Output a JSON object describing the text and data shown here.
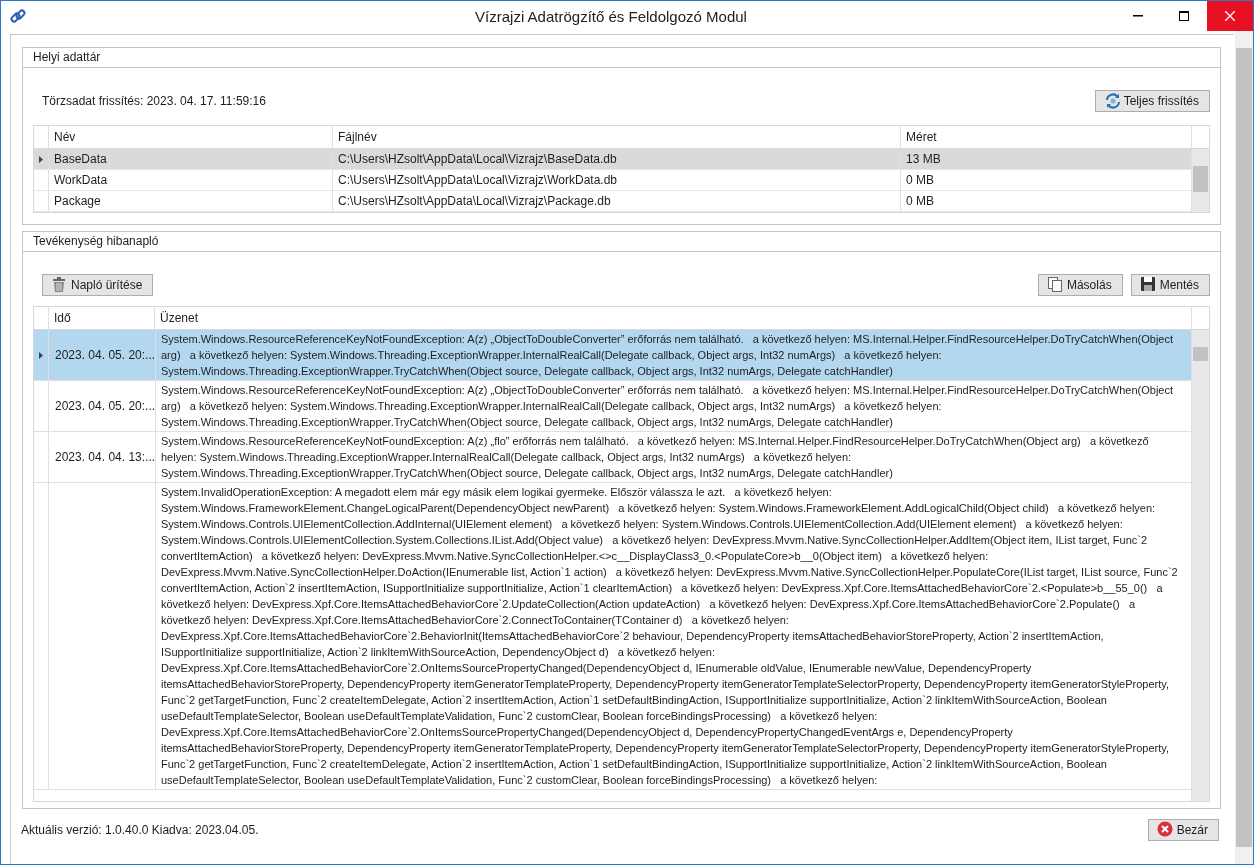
{
  "window": {
    "title": "Vízrajzi Adatrögzítő és Feldolgozó Modul"
  },
  "local_store": {
    "title": "Helyi adattár",
    "sync_label": "Törzsadat frissítés: 2023. 04. 17. 11:59:16",
    "refresh_button": "Teljes frissítés",
    "columns": [
      "Név",
      "Fájlnév",
      "Méret"
    ],
    "rows": [
      {
        "name": "BaseData",
        "file": "C:\\Users\\HZsolt\\AppData\\Local\\Vizrajz\\BaseData.db",
        "size": "13 MB",
        "selected": true
      },
      {
        "name": "WorkData",
        "file": "C:\\Users\\HZsolt\\AppData\\Local\\Vizrajz\\WorkData.db",
        "size": "0 MB",
        "selected": false
      },
      {
        "name": "Package",
        "file": "C:\\Users\\HZsolt\\AppData\\Local\\Vizrajz\\Package.db",
        "size": "0 MB",
        "selected": false
      }
    ]
  },
  "error_log": {
    "title": "Tevékenység hibanapló",
    "clear_button": "Napló ürítése",
    "copy_button": "Másolás",
    "save_button": "Mentés",
    "columns": [
      "Idő",
      "Üzenet"
    ],
    "rows": [
      {
        "time": "2023. 04. 05. 20:...",
        "message": "System.Windows.ResourceReferenceKeyNotFoundException: A(z) „ObjectToDoubleConverter” erőforrás nem található.   a következő helyen: MS.Internal.Helper.FindResourceHelper.DoTryCatchWhen(Object arg)   a következő helyen: System.Windows.Threading.ExceptionWrapper.InternalRealCall(Delegate callback, Object args, Int32 numArgs)   a következő helyen: System.Windows.Threading.ExceptionWrapper.TryCatchWhen(Object source, Delegate callback, Object args, Int32 numArgs, Delegate catchHandler)",
        "selected": true
      },
      {
        "time": "2023. 04. 05. 20:...",
        "message": "System.Windows.ResourceReferenceKeyNotFoundException: A(z) „ObjectToDoubleConverter” erőforrás nem található.   a következő helyen: MS.Internal.Helper.FindResourceHelper.DoTryCatchWhen(Object arg)   a következő helyen: System.Windows.Threading.ExceptionWrapper.InternalRealCall(Delegate callback, Object args, Int32 numArgs)   a következő helyen: System.Windows.Threading.ExceptionWrapper.TryCatchWhen(Object source, Delegate callback, Object args, Int32 numArgs, Delegate catchHandler)",
        "selected": false
      },
      {
        "time": "2023. 04. 04. 13:...",
        "message": "System.Windows.ResourceReferenceKeyNotFoundException: A(z) „flo” erőforrás nem található.   a következő helyen: MS.Internal.Helper.FindResourceHelper.DoTryCatchWhen(Object arg)   a következő helyen: System.Windows.Threading.ExceptionWrapper.InternalRealCall(Delegate callback, Object args, Int32 numArgs)   a következő helyen: System.Windows.Threading.ExceptionWrapper.TryCatchWhen(Object source, Delegate callback, Object args, Int32 numArgs, Delegate catchHandler)",
        "selected": false
      },
      {
        "message": "System.InvalidOperationException: A megadott elem már egy másik elem logikai gyermeke. Először válassza le azt.   a következő helyen: System.Windows.FrameworkElement.ChangeLogicalParent(DependencyObject newParent)   a következő helyen: System.Windows.FrameworkElement.AddLogicalChild(Object child)   a következő helyen: System.Windows.Controls.UIElementCollection.AddInternal(UIElement element)   a következő helyen: System.Windows.Controls.UIElementCollection.Add(UIElement element)   a következő helyen: System.Windows.Controls.UIElementCollection.System.Collections.IList.Add(Object value)   a következő helyen: DevExpress.Mvvm.Native.SyncCollectionHelper.AddItem(Object item, IList target, Func`2 convertItemAction)   a következő helyen: DevExpress.Mvvm.Native.SyncCollectionHelper.<>c__DisplayClass3_0.<PopulateCore>b__0(Object item)   a következő helyen: DevExpress.Mvvm.Native.SyncCollectionHelper.DoAction(IEnumerable list, Action`1 action)   a következő helyen: DevExpress.Mvvm.Native.SyncCollectionHelper.PopulateCore(IList target, IList source, Func`2 convertItemAction, Action`2 insertItemAction, ISupportInitialize supportInitialize, Action`1 clearItemAction)   a következő helyen: DevExpress.Xpf.Core.ItemsAttachedBehaviorCore`2.<Populate>b__55_0()   a következő helyen: DevExpress.Xpf.Core.ItemsAttachedBehaviorCore`2.UpdateCollection(Action updateAction)   a következő helyen: DevExpress.Xpf.Core.ItemsAttachedBehaviorCore`2.Populate()   a következő helyen: DevExpress.Xpf.Core.ItemsAttachedBehaviorCore`2.ConnectToContainer(TContainer d)   a következő helyen: DevExpress.Xpf.Core.ItemsAttachedBehaviorCore`2.BehaviorInit(ItemsAttachedBehaviorCore`2 behaviour, DependencyProperty itemsAttachedBehaviorStoreProperty, Action`2 insertItemAction, ISupportInitialize supportInitialize, Action`2 linkItemWithSourceAction, DependencyObject d)   a következő helyen: DevExpress.Xpf.Core.ItemsAttachedBehaviorCore`2.OnItemsSourcePropertyChanged(DependencyObject d, IEnumerable oldValue, IEnumerable newValue, DependencyProperty itemsAttachedBehaviorStoreProperty, DependencyProperty itemGeneratorTemplateProperty, DependencyProperty itemGeneratorTemplateSelectorProperty, DependencyProperty itemGeneratorStyleProperty, Func`2 getTargetFunction, Func`2 createItemDelegate, Action`2 insertItemAction, Action`1 setDefaultBindingAction, ISupportInitialize supportInitialize, Action`2 linkItemWithSourceAction, Boolean useDefaultTemplateSelector, Boolean useDefaultTemplateValidation, Func`2 customClear, Boolean forceBindingsProcessing)   a következő helyen: DevExpress.Xpf.Core.ItemsAttachedBehaviorCore`2.OnItemsSourcePropertyChanged(DependencyObject d, DependencyPropertyChangedEventArgs e, DependencyProperty itemsAttachedBehaviorStoreProperty, DependencyProperty itemGeneratorTemplateProperty, DependencyProperty itemGeneratorTemplateSelectorProperty, DependencyProperty itemGeneratorStyleProperty, Func`2 getTargetFunction, Func`2 createItemDelegate, Action`2 insertItemAction, Action`1 setDefaultBindingAction, ISupportInitialize supportInitialize, Action`2 linkItemWithSourceAction, Boolean useDefaultTemplateSelector, Boolean useDefaultTemplateValidation, Func`2 customClear, Boolean forceBindingsProcessing)   a következő helyen:",
        "selected": false
      }
    ]
  },
  "status": {
    "version": "Aktuális verzió: 1.0.40.0 Kiadva: 2023.04.05.",
    "close_button": "Bezár"
  }
}
